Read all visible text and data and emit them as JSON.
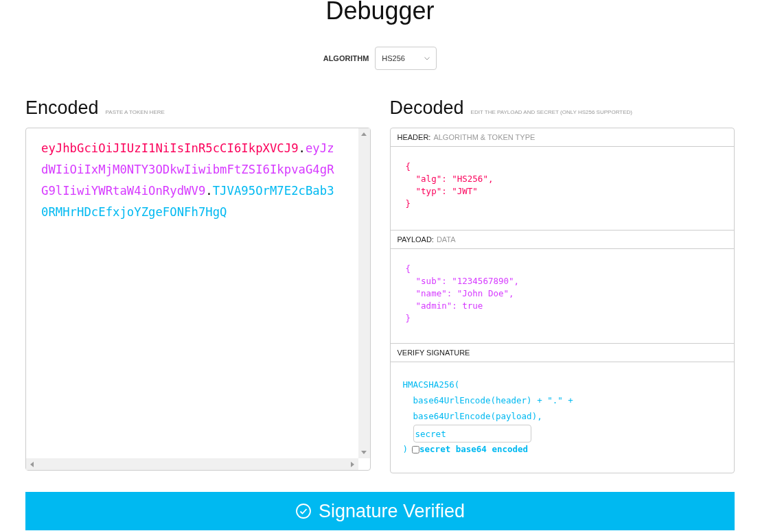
{
  "title": "Debugger",
  "algorithm": {
    "label": "ALGORITHM",
    "value": "HS256"
  },
  "encoded": {
    "heading": "Encoded",
    "hint": "PASTE A TOKEN HERE",
    "lines": [
      [
        {
          "kind": "header",
          "text": "eyJhbGciOiJIUzI1NiIsInR5cCI6IkpXVCJ9"
        },
        {
          "kind": "separator",
          "text": "."
        },
        {
          "kind": "payload",
          "text": "eyJz"
        }
      ],
      [
        {
          "kind": "payload",
          "text": "dWIiOiIxMjM0NTY3ODkwIiwibmFtZSI6IkpvaG4gR"
        }
      ],
      [
        {
          "kind": "payload",
          "text": "G9lIiwiYWRtaW4iOnRydWV9"
        },
        {
          "kind": "separator",
          "text": "."
        },
        {
          "kind": "signature",
          "text": "TJVA95OrM7E2cBab3"
        }
      ],
      [
        {
          "kind": "signature",
          "text": "0RMHrHDcEfxjoYZgeFONFh7HgQ"
        }
      ]
    ]
  },
  "decoded": {
    "heading": "Decoded",
    "hint": "EDIT THE PAYLOAD AND SECRET (ONLY HS256 SUPPORTED)",
    "sections": [
      {
        "kind": "header",
        "label": "HEADER:",
        "sublabel": "ALGORITHM & TOKEN TYPE",
        "lines": [
          "{",
          "  \"alg\": \"HS256\",",
          "  \"typ\": \"JWT\"",
          "}"
        ]
      },
      {
        "kind": "payload",
        "label": "PAYLOAD:",
        "sublabel": "DATA",
        "lines": [
          "{",
          "  \"sub\": \"1234567890\",",
          "  \"name\": \"John Doe\",",
          "  \"admin\": true",
          "}"
        ]
      },
      {
        "kind": "signature",
        "label": "VERIFY SIGNATURE",
        "lines": [
          "HMACSHA256(",
          "  base64UrlEncode(header) + \".\" +",
          "  base64UrlEncode(payload),"
        ],
        "secret": {
          "value": "secret"
        },
        "close": ")",
        "checkbox": {
          "label": "secret base64 encoded",
          "checked": false
        }
      }
    ]
  },
  "status": {
    "text": "Signature Verified",
    "verified": true
  }
}
